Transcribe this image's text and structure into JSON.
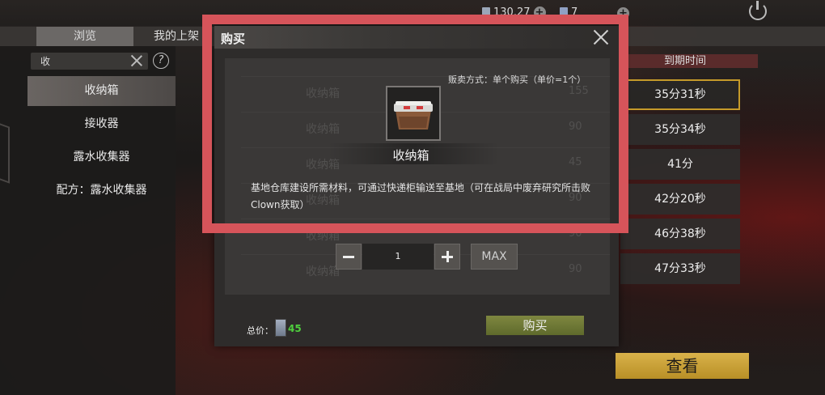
{
  "top_bar": {
    "currency_amount": "130.27",
    "secondary_amount": "7"
  },
  "tabs": [
    {
      "label": "浏览",
      "active": true
    },
    {
      "label": "我的上架",
      "active": false
    }
  ],
  "sidebar": {
    "search": {
      "value": "收"
    },
    "items": [
      {
        "label": "收纳箱",
        "active": true
      },
      {
        "label": "接收器",
        "active": false
      },
      {
        "label": "露水收集器",
        "active": false
      },
      {
        "label": "配方：露水收集器",
        "active": false
      }
    ]
  },
  "listing": {
    "expiry_header": "到期时间",
    "expiry_times": [
      "35分31秒",
      "35分34秒",
      "41分",
      "42分20秒",
      "46分38秒",
      "47分33秒"
    ],
    "selected_index": 0,
    "view_button": "查看"
  },
  "modal": {
    "title": "购买",
    "sale_method": "贩卖方式：单个购买（单价=1个）",
    "item": {
      "name": "收纳箱",
      "icon": "storage-box-icon",
      "description": "基地仓库建设所需材料，可通过快递柜输送至基地（可在战局中废弃研究所击败Clown获取）"
    },
    "background_rows": [
      {
        "name": "收纳箱",
        "qty": "155"
      },
      {
        "name": "收纳箱",
        "qty": "90"
      },
      {
        "name": "收纳箱",
        "qty": "45"
      },
      {
        "name": "收纳箱",
        "qty": "90"
      },
      {
        "name": "收纳箱",
        "qty": "90"
      },
      {
        "name": "收纳箱",
        "qty": "90"
      }
    ],
    "quantity": "1",
    "max_label": "MAX",
    "total_label": "总价：",
    "total_value": "45",
    "buy_label": "购买"
  },
  "colors": {
    "highlight": "#d6545a",
    "price_green": "#4fcf3e",
    "selected_border": "#c59a2a",
    "view_button": "#d9b24a",
    "buy_button": "#7e8740"
  }
}
